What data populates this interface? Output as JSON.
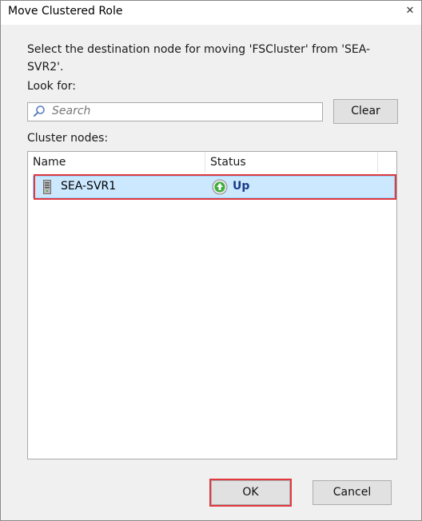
{
  "window": {
    "title": "Move Clustered Role",
    "close_glyph": "✕"
  },
  "prompt": "Select the destination node for moving 'FSCluster' from 'SEA-SVR2'.",
  "look_for": {
    "label": "Look for:",
    "search_placeholder": "Search",
    "search_value": "",
    "clear_label": "Clear"
  },
  "cluster_nodes": {
    "label": "Cluster nodes:",
    "columns": [
      "Name",
      "Status"
    ],
    "rows": [
      {
        "name": "SEA-SVR1",
        "status": "Up",
        "icon": "server-icon",
        "status_icon": "green-up-arrow-icon",
        "selected": true
      }
    ]
  },
  "buttons": {
    "ok_label": "OK",
    "cancel_label": "Cancel"
  },
  "colors": {
    "selection_bg": "#cce8ff",
    "highlight_red": "#e0383e",
    "status_up": "#1a3a8a"
  }
}
